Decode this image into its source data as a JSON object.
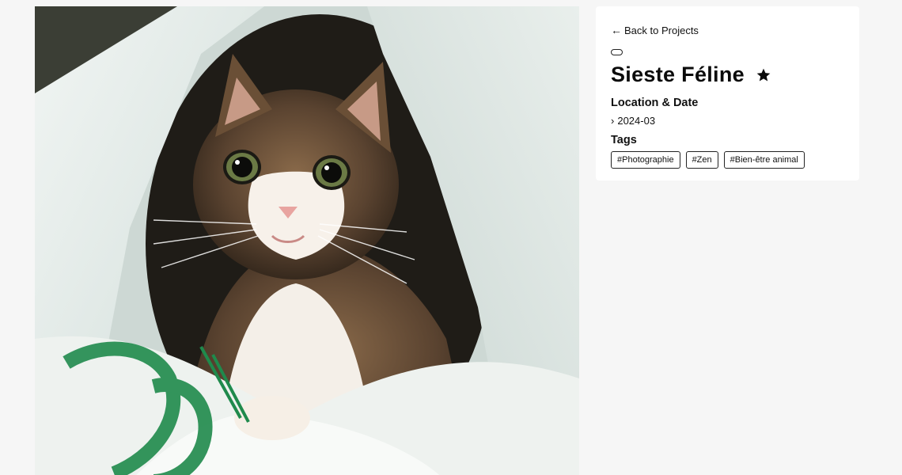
{
  "nav": {
    "back_label": "Back to Projects",
    "back_icon": "left-arrow-icon"
  },
  "project": {
    "title": "Sieste Féline",
    "favorite_icon": "star-icon",
    "location_date_heading": "Location & Date",
    "date": "2024-03",
    "tags_heading": "Tags",
    "tags": [
      "#Photographie",
      "#Zen",
      "#Bien-être animal"
    ]
  },
  "colors": {
    "page_background": "#f6f6f6",
    "card_background": "#ffffff",
    "text": "#111111",
    "bag_print_green": "#1f8a4c"
  }
}
